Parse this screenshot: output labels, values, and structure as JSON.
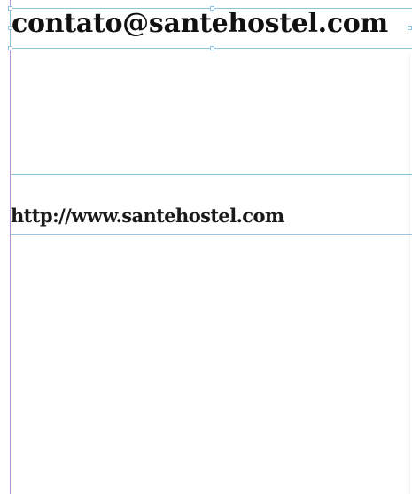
{
  "document": {
    "frames": [
      {
        "id": "email-frame",
        "text": "contato@santehostel.com",
        "selected": true
      },
      {
        "id": "url-frame",
        "text": "http://www.santehostel.com",
        "selected": false
      }
    ]
  },
  "colors": {
    "frame_guide": "#8fc3df",
    "margin_guide": "#b98ed6",
    "text": "#111111",
    "background": "#ffffff"
  }
}
